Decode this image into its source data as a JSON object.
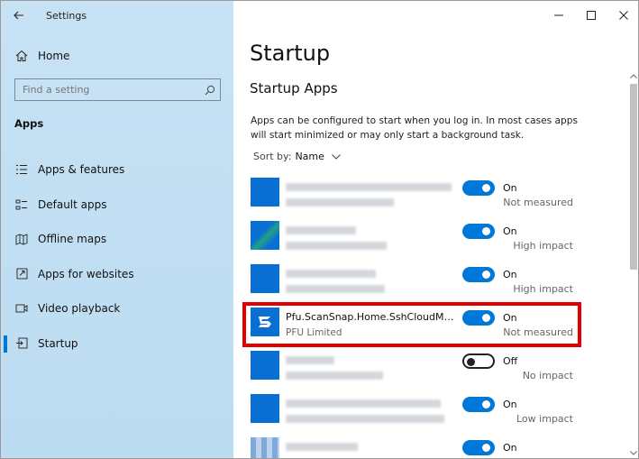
{
  "window": {
    "title": "Settings"
  },
  "sidebar": {
    "home_label": "Home",
    "search_placeholder": "Find a setting",
    "section": "Apps",
    "items": [
      {
        "label": "Apps & features",
        "icon": "list-icon",
        "active": false
      },
      {
        "label": "Default apps",
        "icon": "default-apps-icon",
        "active": false
      },
      {
        "label": "Offline maps",
        "icon": "map-icon",
        "active": false
      },
      {
        "label": "Apps for websites",
        "icon": "website-icon",
        "active": false
      },
      {
        "label": "Video playback",
        "icon": "video-icon",
        "active": false
      },
      {
        "label": "Startup",
        "icon": "startup-icon",
        "active": true
      }
    ]
  },
  "main": {
    "title": "Startup",
    "subtitle": "Startup Apps",
    "description": "Apps can be configured to start when you log in. In most cases apps will start minimized or may only start a background task.",
    "sort_label": "Sort by:",
    "sort_value": "Name",
    "apps": [
      {
        "name": "",
        "publisher": "",
        "blurred": true,
        "state": "On",
        "impact": "Not measured"
      },
      {
        "name": "",
        "publisher": "",
        "blurred": true,
        "state": "On",
        "impact": "High impact"
      },
      {
        "name": "",
        "publisher": "",
        "blurred": true,
        "state": "On",
        "impact": "High impact"
      },
      {
        "name": "Pfu.ScanSnap.Home.SshCloudMonit...",
        "publisher": "PFU Limited",
        "blurred": false,
        "state": "On",
        "impact": "Not measured"
      },
      {
        "name": "",
        "publisher": "",
        "blurred": true,
        "state": "Off",
        "impact": "No impact"
      },
      {
        "name": "",
        "publisher": "",
        "blurred": true,
        "state": "On",
        "impact": "Low impact"
      },
      {
        "name": "",
        "publisher": "",
        "blurred": true,
        "state": "On",
        "impact": ""
      }
    ]
  },
  "colors": {
    "accent": "#0078d7",
    "sidebar_bg": "#c7e2f4",
    "highlight": "#e00000"
  }
}
